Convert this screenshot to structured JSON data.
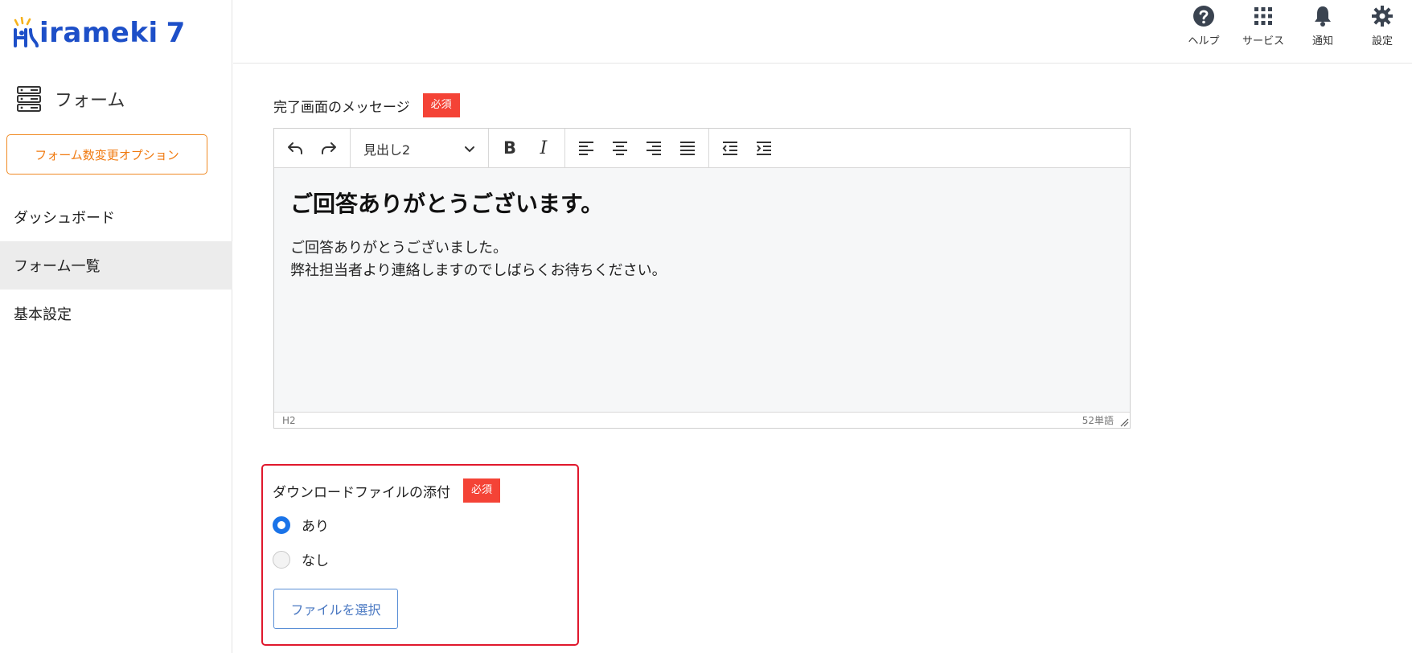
{
  "brand": {
    "logo_text": "irameki",
    "logo_num": "7",
    "accent": "#1d4fc8",
    "sun_color": "#f6b21c"
  },
  "sidebar": {
    "section_title": "フォーム",
    "section_icon": "server-icon",
    "option_button": "フォーム数変更オプション",
    "items": [
      {
        "label": "ダッシュボード",
        "active": false
      },
      {
        "label": "フォーム一覧",
        "active": true
      },
      {
        "label": "基本設定",
        "active": false
      }
    ]
  },
  "topbar": {
    "icons": [
      {
        "name": "help-icon",
        "label": "ヘルプ"
      },
      {
        "name": "grid-icon",
        "label": "サービス"
      },
      {
        "name": "bell-icon",
        "label": "通知"
      },
      {
        "name": "gear-icon",
        "label": "設定"
      }
    ]
  },
  "message_field": {
    "label": "完了画面のメッセージ",
    "required_badge": "必須",
    "toolbar": {
      "heading_value": "見出し2",
      "bold": "B",
      "italic": "I"
    },
    "content": {
      "heading": "ご回答ありがとうございます。",
      "line1": "ご回答ありがとうございました。",
      "line2": "弊社担当者より連絡しますのでしばらくお待ちください。"
    },
    "status": {
      "element_path": "H2",
      "word_count": "52単語"
    }
  },
  "download_field": {
    "label": "ダウンロードファイルの添付",
    "required_badge": "必須",
    "options": [
      {
        "label": "あり",
        "selected": true
      },
      {
        "label": "なし",
        "selected": false
      }
    ],
    "file_button": "ファイルを選択"
  },
  "colors": {
    "required": "#f44336",
    "highlight_border": "#e0182d",
    "radio_on": "#1a73e8",
    "option_btn": "#f07a10"
  }
}
